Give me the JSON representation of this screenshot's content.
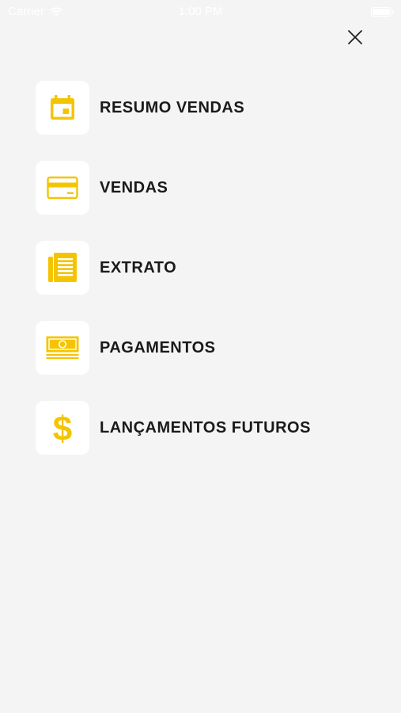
{
  "status_bar": {
    "carrier": "Carrier",
    "time": "1:00 PM",
    "icons": [
      "wifi-icon",
      "battery-icon"
    ],
    "battery_level": 1.0
  },
  "header": {
    "close_icon": "close-icon"
  },
  "colors": {
    "background": "#f4f4f4",
    "accent": "#f5c400",
    "label": "#1a1a1a",
    "tile": "#ffffff"
  },
  "menu": {
    "items": [
      {
        "label": "RESUMO VENDAS",
        "icon": "calendar-icon"
      },
      {
        "label": "VENDAS",
        "icon": "credit-card-icon"
      },
      {
        "label": "EXTRATO",
        "icon": "document-icon"
      },
      {
        "label": "PAGAMENTOS",
        "icon": "banknote-icon"
      },
      {
        "label": "LANÇAMENTOS FUTUROS",
        "icon": "dollar-icon"
      }
    ]
  }
}
